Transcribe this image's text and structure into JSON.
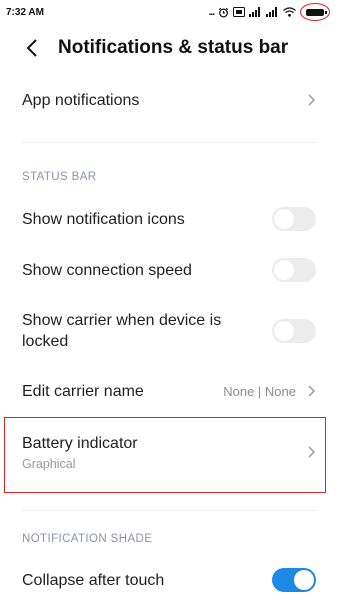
{
  "status_bar": {
    "time": "7:32 AM",
    "dots": "..."
  },
  "header": {
    "title": "Notifications & status bar"
  },
  "rows": {
    "app_notifications": {
      "label": "App notifications"
    },
    "status_bar_section": "STATUS BAR",
    "show_notification_icons": {
      "label": "Show notification icons",
      "enabled": false
    },
    "show_connection_speed": {
      "label": "Show connection speed",
      "enabled": false
    },
    "show_carrier_locked": {
      "label": "Show carrier when device is locked",
      "enabled": false
    },
    "edit_carrier_name": {
      "label": "Edit carrier name",
      "value": "None | None"
    },
    "battery_indicator": {
      "label": "Battery indicator",
      "value": "Graphical"
    },
    "notification_shade_section": "NOTIFICATION SHADE",
    "collapse_after_touch": {
      "label": "Collapse after touch",
      "enabled": true
    }
  },
  "colors": {
    "accent": "#1e88e5",
    "highlight": "#d7262b"
  }
}
